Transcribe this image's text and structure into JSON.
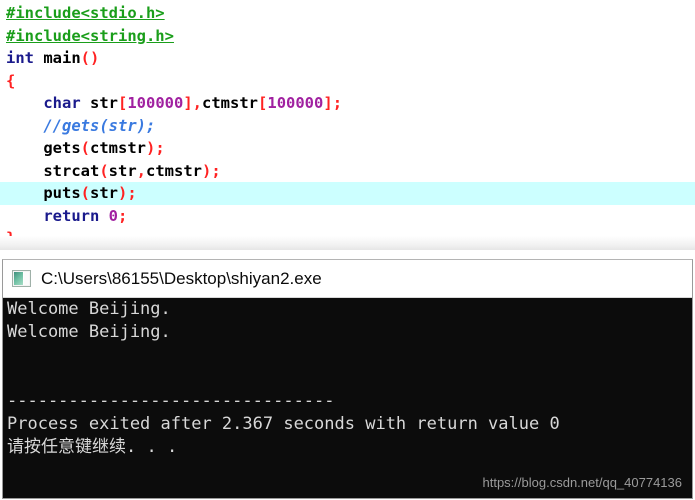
{
  "editor": {
    "highlighted_line_index": 8,
    "lines": [
      {
        "indent": 0,
        "tokens": [
          {
            "t": "#include<stdio.h>",
            "c": "pre"
          }
        ]
      },
      {
        "indent": 0,
        "tokens": [
          {
            "t": "#include<string.h>",
            "c": "pre"
          }
        ]
      },
      {
        "indent": 0,
        "tokens": [
          {
            "t": "int",
            "c": "kw"
          },
          {
            "t": " ",
            "c": "id"
          },
          {
            "t": "main",
            "c": "id"
          },
          {
            "t": "()",
            "c": "punct"
          }
        ]
      },
      {
        "indent": 0,
        "tokens": [
          {
            "t": "{",
            "c": "punct"
          }
        ]
      },
      {
        "indent": 4,
        "tokens": [
          {
            "t": "char",
            "c": "kw"
          },
          {
            "t": " str",
            "c": "id"
          },
          {
            "t": "[",
            "c": "punct"
          },
          {
            "t": "100000",
            "c": "num"
          },
          {
            "t": "]",
            "c": "punct"
          },
          {
            "t": ",",
            "c": "punct"
          },
          {
            "t": "ctmstr",
            "c": "id"
          },
          {
            "t": "[",
            "c": "punct"
          },
          {
            "t": "100000",
            "c": "num"
          },
          {
            "t": "]",
            "c": "punct"
          },
          {
            "t": ";",
            "c": "punct"
          }
        ]
      },
      {
        "indent": 4,
        "tokens": [
          {
            "t": "//gets(str);",
            "c": "comment"
          }
        ]
      },
      {
        "indent": 4,
        "tokens": [
          {
            "t": "gets",
            "c": "id"
          },
          {
            "t": "(",
            "c": "punct"
          },
          {
            "t": "ctmstr",
            "c": "id"
          },
          {
            "t": ")",
            "c": "punct"
          },
          {
            "t": ";",
            "c": "punct"
          }
        ]
      },
      {
        "indent": 4,
        "tokens": [
          {
            "t": "strcat",
            "c": "id"
          },
          {
            "t": "(",
            "c": "punct"
          },
          {
            "t": "str",
            "c": "id"
          },
          {
            "t": ",",
            "c": "punct"
          },
          {
            "t": "ctmstr",
            "c": "id"
          },
          {
            "t": ")",
            "c": "punct"
          },
          {
            "t": ";",
            "c": "punct"
          }
        ]
      },
      {
        "indent": 4,
        "tokens": [
          {
            "t": "puts",
            "c": "id"
          },
          {
            "t": "(",
            "c": "punct"
          },
          {
            "t": "str",
            "c": "id"
          },
          {
            "t": ")",
            "c": "punct"
          },
          {
            "t": ";",
            "c": "punct"
          }
        ]
      },
      {
        "indent": 4,
        "tokens": [
          {
            "t": "return",
            "c": "kw"
          },
          {
            "t": " ",
            "c": "id"
          },
          {
            "t": "0",
            "c": "num"
          },
          {
            "t": ";",
            "c": "punct"
          }
        ]
      },
      {
        "indent": 0,
        "tokens": [
          {
            "t": "}",
            "c": "punct"
          }
        ]
      }
    ],
    "colors": {
      "preprocessor": "#1a9e1a",
      "keyword": "#1a1a8c",
      "identifier": "#000000",
      "punctuation": "#ff2222",
      "number": "#a020a0",
      "comment": "#3a7ae0",
      "current_line_highlight": "#ccffff",
      "background": "#ffffff"
    }
  },
  "console": {
    "icon_name": "console-window-icon",
    "title": "C:\\Users\\86155\\Desktop\\shiyan2.exe",
    "background": "#0c0c0c",
    "foreground": "#d8d8d8",
    "output_lines": [
      "Welcome Beijing.",
      "Welcome Beijing.",
      "",
      "",
      "--------------------------------",
      "Process exited after 2.367 seconds with return value 0",
      "请按任意键继续. . ."
    ]
  },
  "watermark": {
    "text": "https://blog.csdn.net/qq_40774136",
    "color": "#9b9b9b"
  }
}
